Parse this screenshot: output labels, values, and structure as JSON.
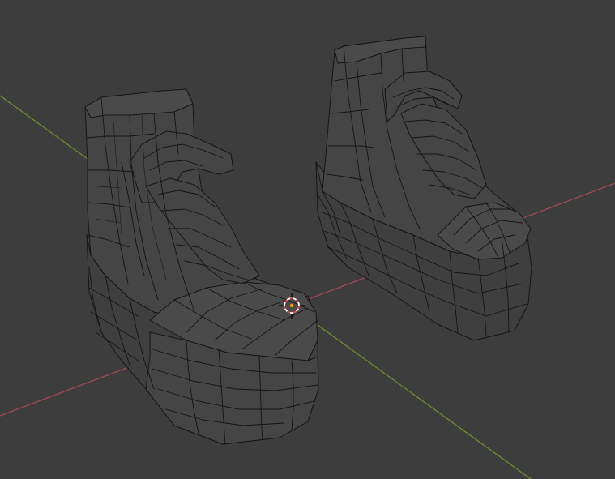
{
  "viewport": {
    "background_color": "#3d3d3d",
    "mesh_fill_color": "#454545",
    "wire_color": "#141414"
  },
  "axes": {
    "x_axis_color": "#9b4a52",
    "y_axis_color": "#6a8a2c"
  },
  "cursor": {
    "icon": "3d-cursor-icon",
    "ring_color_a": "#e04545",
    "ring_color_b": "#ffffff",
    "center_color": "#ff9900"
  },
  "objects": [
    {
      "name": "left-boot",
      "icon": "boot-mesh"
    },
    {
      "name": "right-boot",
      "icon": "boot-mesh"
    }
  ]
}
